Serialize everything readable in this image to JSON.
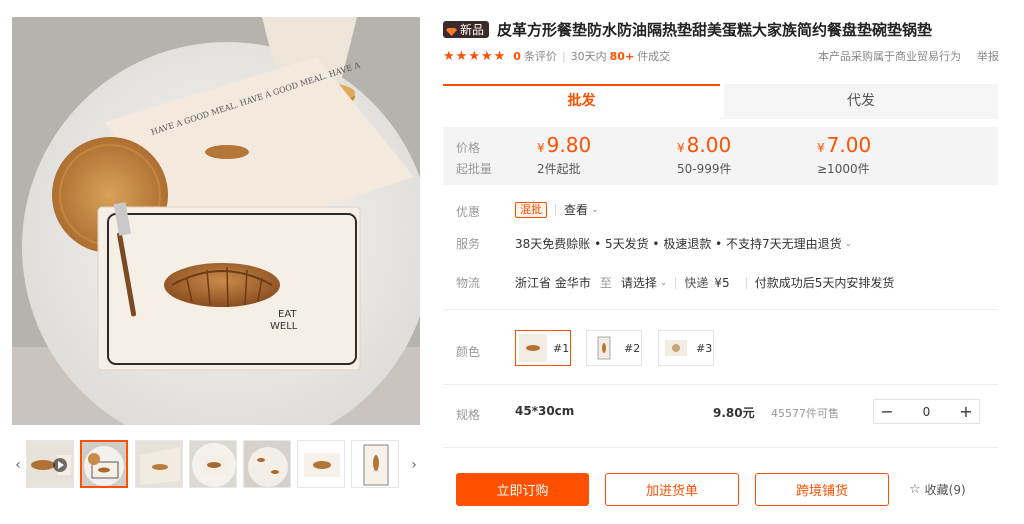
{
  "gallery": {
    "thumb_count": 7,
    "active_index": 1,
    "prev_label": "‹",
    "next_label": "›",
    "main_image_text": {
      "eat": "EAT",
      "well": "WELL",
      "arc": "HAVE A GOOD MEAL. HAVE A GOOD MEAL. HAVE A"
    }
  },
  "product": {
    "badge": "新品",
    "title": "皮革方形餐垫防水防油隔热垫甜美蛋糕大家族简约餐盘垫碗垫锅垫"
  },
  "rating": {
    "stars": 5,
    "review_count": "0",
    "review_label": "条评价",
    "sales_period": "30天内",
    "sales_count": "80+",
    "sales_label": "件成交",
    "trade_note": "本产品采购属于商业贸易行为",
    "report": "举报"
  },
  "tabs": [
    {
      "label": "批发",
      "active": true
    },
    {
      "label": "代发",
      "active": false
    }
  ],
  "pricing": {
    "price_label": "价格",
    "moq_label": "起批量",
    "currency": "¥",
    "tiers": [
      {
        "price": "9.80",
        "qty": "2件起批"
      },
      {
        "price": "8.00",
        "qty": "50-999件"
      },
      {
        "price": "7.00",
        "qty": "≥1000件"
      }
    ]
  },
  "promo": {
    "label": "优惠",
    "tag": "混批",
    "view": "查看"
  },
  "service": {
    "label": "服务",
    "text": "38天免费赊账 • 5天发货 • 极速退款 • 不支持7天无理由退货"
  },
  "logistics": {
    "label": "物流",
    "origin": "浙江省 金华市",
    "to": "至",
    "destination": "请选择",
    "express_label": "快递",
    "fee": "¥5",
    "ship_note": "付款成功后5天内安排发货"
  },
  "colors": {
    "label": "颜色",
    "options": [
      {
        "label": "#1",
        "selected": true
      },
      {
        "label": "#2",
        "selected": false
      },
      {
        "label": "#3",
        "selected": false
      }
    ]
  },
  "spec": {
    "label": "规格",
    "size": "45*30cm",
    "price": "9.80元",
    "stock": "45577件可售",
    "quantity": "0",
    "minus": "−",
    "plus": "+"
  },
  "actions": {
    "buy_now": "立即订购",
    "add_to_list": "加进货单",
    "cross_border": "跨境铺货",
    "favorite": "收藏(9)"
  },
  "colors_theme": {
    "accent": "#ff5000",
    "price_bg": "#f4f4f4",
    "badge_bg": "#3a2a2a"
  }
}
